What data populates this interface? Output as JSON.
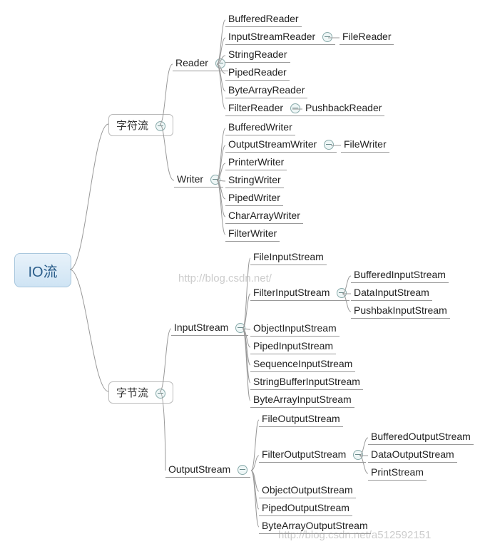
{
  "watermarks": {
    "top": "http://blog.csdn.net/",
    "bottom": "http://blog.csdn.net/a512592151"
  },
  "root": {
    "label": "IO流"
  },
  "charStream": {
    "label": "字符流",
    "reader": {
      "label": "Reader",
      "children": {
        "buffered": "BufferedReader",
        "isr": "InputStreamReader",
        "isr_child": "FileReader",
        "string": "StringReader",
        "piped": "PipedReader",
        "bytearray": "ByteArrayReader",
        "filter": "FilterReader",
        "filter_child": "PushbackReader"
      }
    },
    "writer": {
      "label": "Writer",
      "children": {
        "buffered": "BufferedWriter",
        "osw": "OutputStreamWriter",
        "osw_child": "FileWriter",
        "printer": "PrinterWriter",
        "string": "StringWriter",
        "piped": "PipedWriter",
        "chararray": "CharArrayWriter",
        "filter": "FilterWriter"
      }
    }
  },
  "byteStream": {
    "label": "字节流",
    "input": {
      "label": "InputStream",
      "children": {
        "file": "FileInputStream",
        "filter": "FilterInputStream",
        "filter_children": {
          "buffered": "BufferedInputStream",
          "data": "DataInputStream",
          "pushback": "PushbakInputStream"
        },
        "object": "ObjectInputStream",
        "piped": "PipedInputStream",
        "sequence": "SequenceInputStream",
        "stringbuffer": "StringBufferInputStream",
        "bytearray": "ByteArrayInputStream"
      }
    },
    "output": {
      "label": "OutputStream",
      "children": {
        "file": "FileOutputStream",
        "filter": "FilterOutputStream",
        "filter_children": {
          "buffered": "BufferedOutputStream",
          "data": "DataOutputStream",
          "print": "PrintStream"
        },
        "object": "ObjectOutputStream",
        "piped": "PipedOutputStream",
        "bytearray": "ByteArrayOutputStream"
      }
    }
  }
}
